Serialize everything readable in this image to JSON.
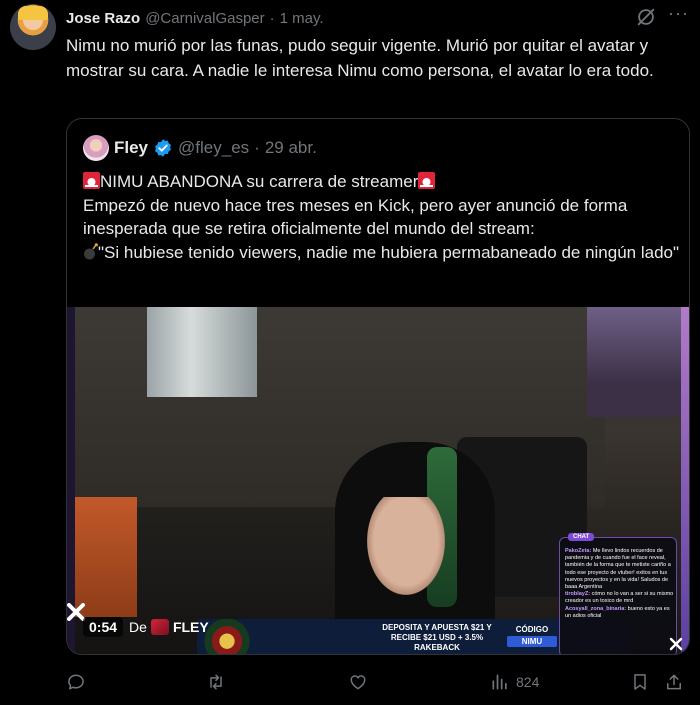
{
  "author": {
    "name": "Jose Razo",
    "handle": "@CarnivalGasper",
    "separator": "·",
    "date": "1 may."
  },
  "post_text": "Nimu no murió por las funas, pudo seguir vigente. Murió por quitar el avatar y mostrar su cara. A nadie le interesa Nimu como persona, el avatar lo era todo.",
  "quoted": {
    "name": "Fley",
    "handle": "@fley_es",
    "separator": "·",
    "date": "29 abr.",
    "headline": "NIMU ABANDONA su carrera de streamer",
    "line2": "Empezó de nuevo hace tres meses en Kick, pero ayer anunció de forma inesperada que se retira oficialmente del mundo del stream:",
    "quote": "\"Si hubiese tenido viewers, nadie me hubiera permabaneado de ningún lado\"",
    "media": {
      "duration": "0:54",
      "channel_prefix": "De",
      "channel": "FLEY",
      "ad_line1": "DEPOSITA Y APUESTA $21 Y",
      "ad_line2": "RECIBE $21 USD + 3.5%",
      "ad_line3": "RAKEBACK",
      "code_label": "CÓDIGO",
      "code_value": "NIMU",
      "chat_tag": "CHAT",
      "chat_lines": [
        {
          "user": "PakoZeta:",
          "text": "Me llevo lindos recuerdos de pandemia y de cuando fue el face reveal, también de la forma que te metiste cariño a todo ese proyecto de vtuber! exitos en tus nuevos proyectos y en la vida! Saludos de baaa Argentina"
        },
        {
          "user": "tirobIayZ:",
          "text": "cómo no lo van a ser si su mismo creador es un toxico de mrd"
        },
        {
          "user": "Acosyall_zona_binaria:",
          "text": "bueno esto ya es un adios oficial"
        }
      ]
    }
  },
  "actions": {
    "views": "824"
  },
  "icons": {
    "grok": "grok-icon",
    "more": "more-icon",
    "verified": "verified-badge-icon",
    "reply": "reply-icon",
    "repost": "repost-icon",
    "like": "like-icon",
    "views": "views-icon",
    "bookmark": "bookmark-icon",
    "share": "share-icon"
  },
  "colors": {
    "text": "#e7e9ea",
    "muted": "#71767b",
    "border": "#2f3336",
    "verified": "#1d9bf0",
    "siren": "#e0243a"
  }
}
